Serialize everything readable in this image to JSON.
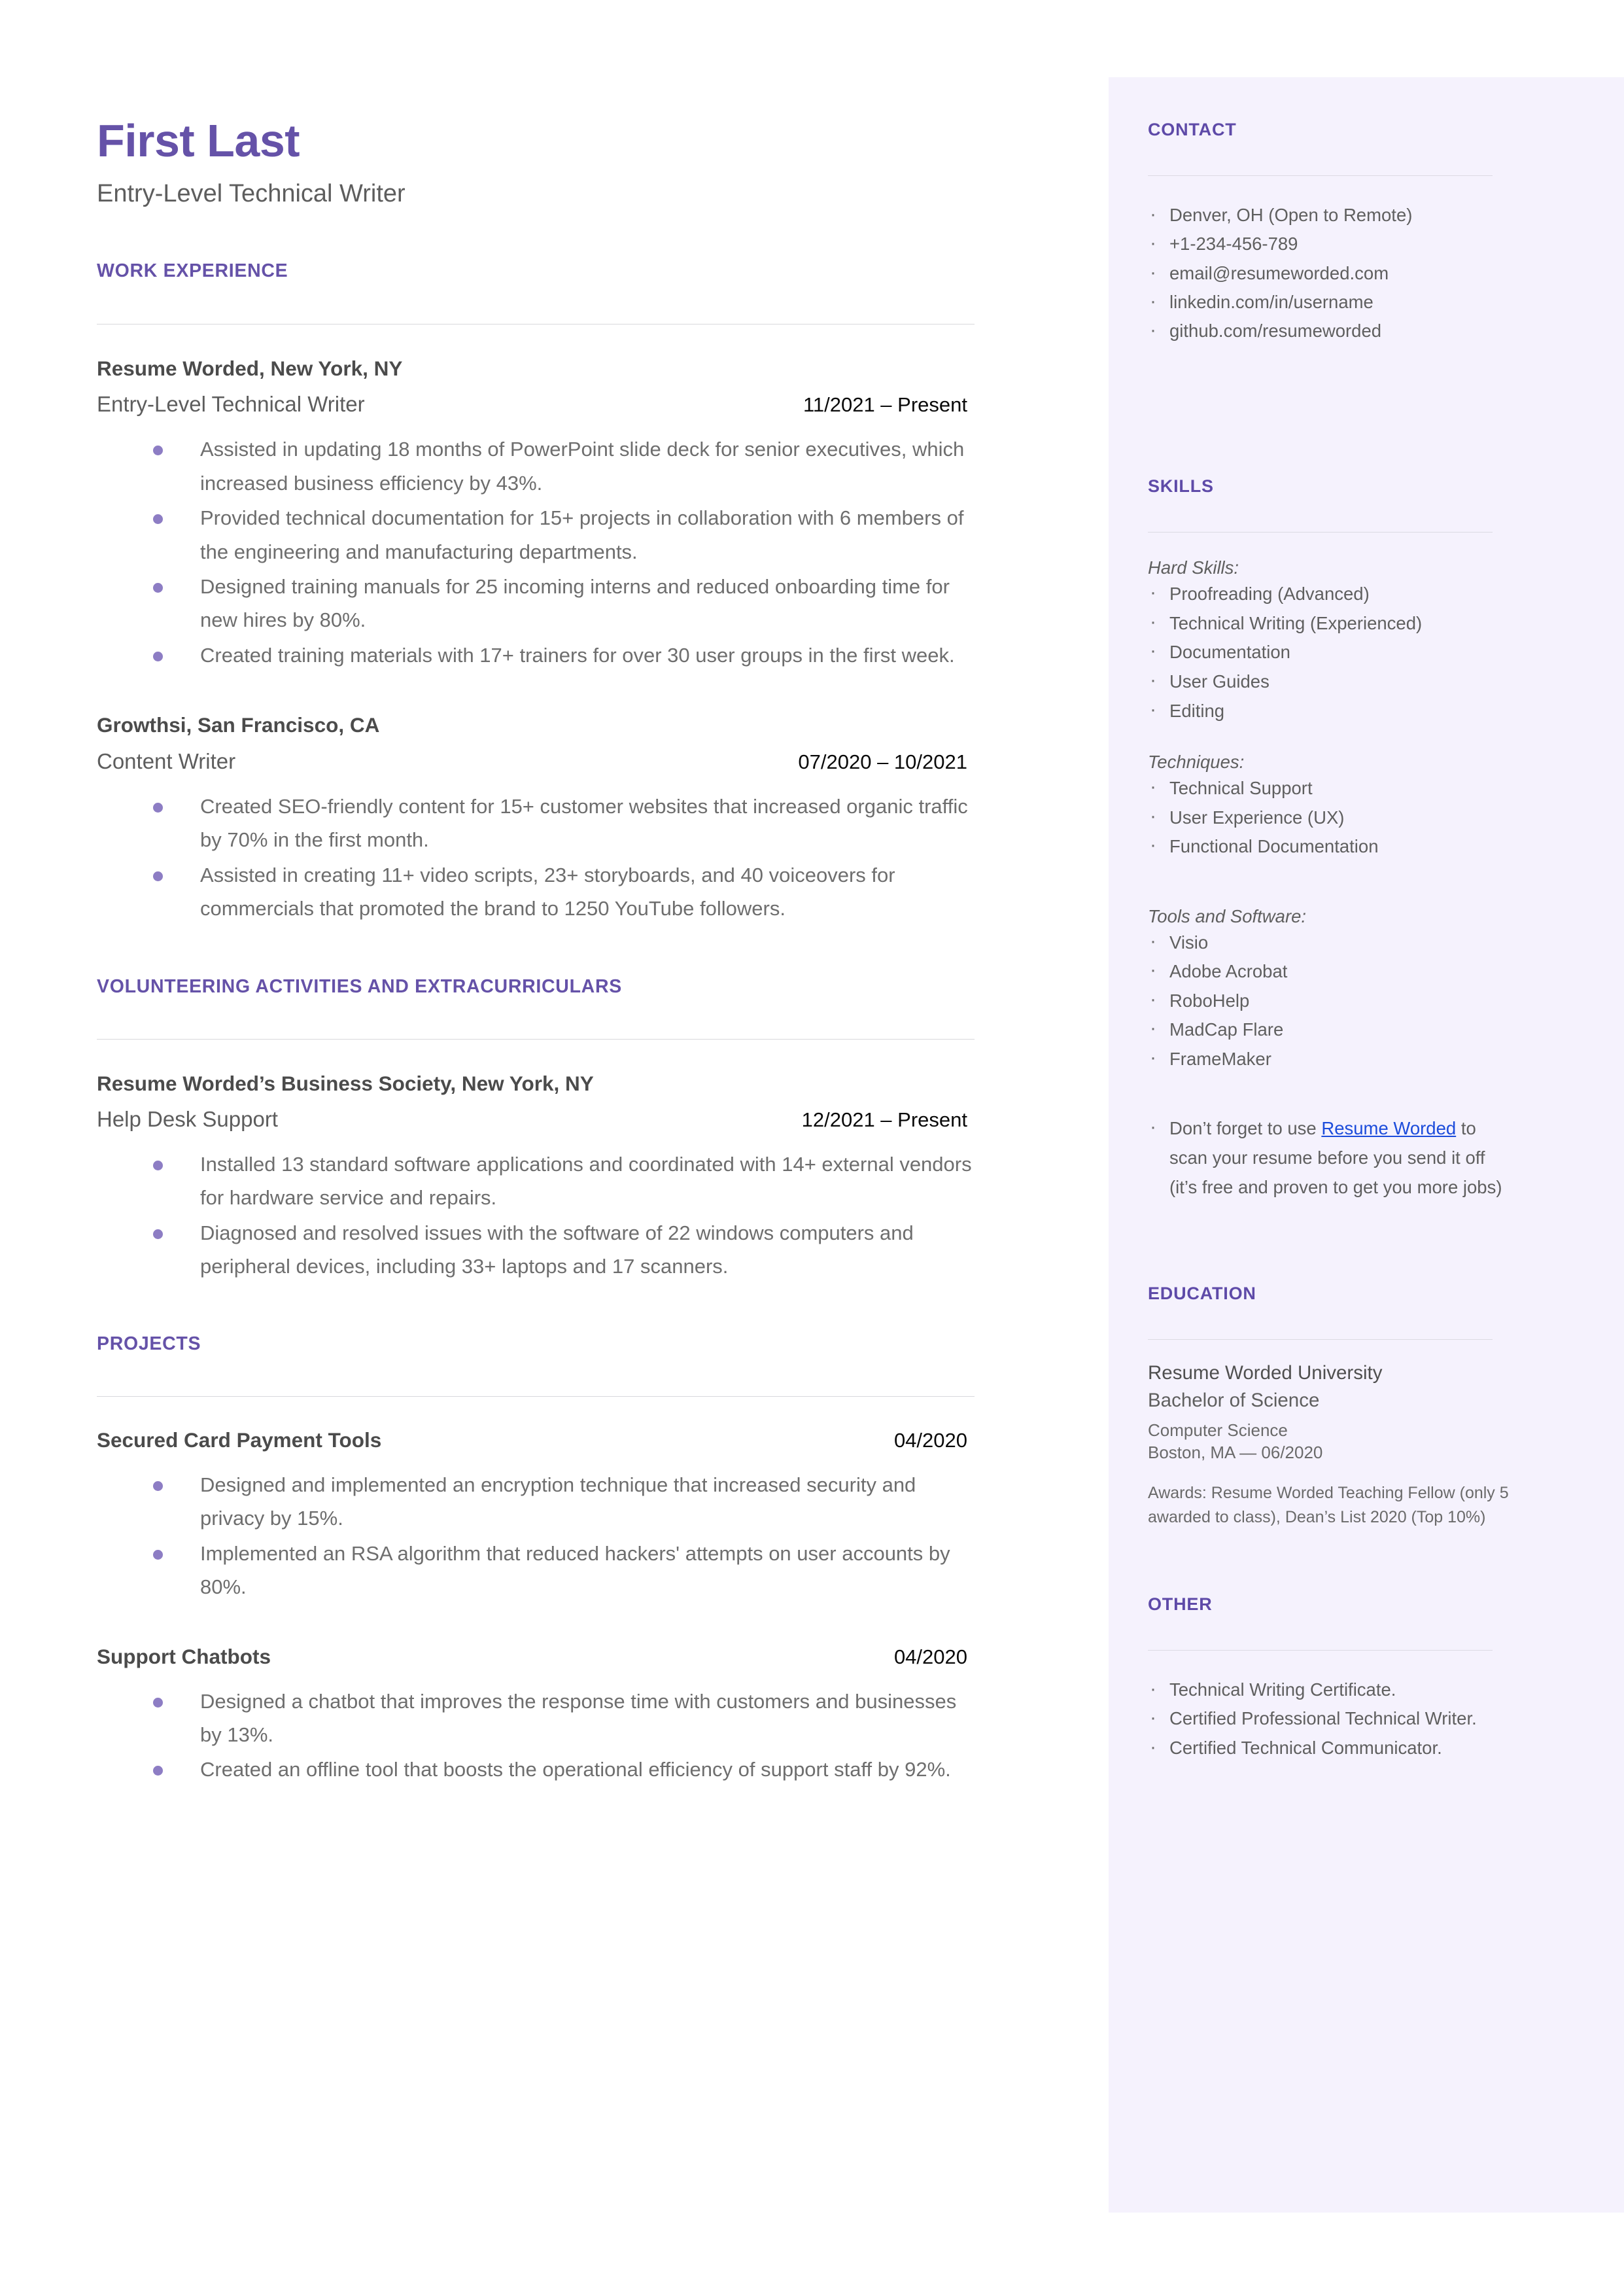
{
  "theme": {
    "accent_purple": "#6552a8",
    "sidebar_purple": "#5e4aa8",
    "sidebar_bg": "#f5f2fd",
    "bullet_purple": "#8d7dc4",
    "link_blue": "#1c4cdb",
    "body_gray": "#6e6e6e"
  },
  "header": {
    "name": "First Last",
    "headline": "Entry-Level Technical Writer"
  },
  "main": {
    "sections": [
      {
        "title": "WORK EXPERIENCE",
        "entries": [
          {
            "org": "Resume Worded, New York, NY",
            "role": "Entry-Level Technical Writer",
            "dates": "11/2021 – Present",
            "bullets": [
              "Assisted in updating 18 months of PowerPoint slide deck for senior executives, which increased business efficiency by 43%.",
              "Provided technical documentation for 15+ projects in collaboration with 6 members of the engineering and manufacturing departments.",
              "Designed training manuals for 25 incoming interns and reduced onboarding time for new hires by 80%.",
              "Created training materials with 17+ trainers for over 30 user groups in the first week."
            ]
          },
          {
            "org": "Growthsi, San Francisco, CA",
            "role": "Content Writer",
            "dates": "07/2020 – 10/2021",
            "bullets": [
              "Created SEO-friendly content for 15+ customer websites that increased organic traffic by 70% in the first month.",
              "Assisted in creating 11+ video scripts, 23+ storyboards, and 40 voiceovers for commercials that promoted the brand to 1250 YouTube followers."
            ]
          }
        ]
      },
      {
        "title": "VOLUNTEERING ACTIVITIES AND EXTRACURRICULARS",
        "entries": [
          {
            "org": "Resume Worded’s Business Society, New York, NY",
            "role": "Help Desk Support",
            "dates": "12/2021 – Present",
            "bullets": [
              "Installed 13 standard software applications and coordinated with 14+ external vendors for hardware service and repairs.",
              "Diagnosed and resolved issues with the software of 22 windows computers and peripheral devices, including 33+ laptops and 17 scanners."
            ]
          }
        ]
      },
      {
        "title": "PROJECTS",
        "projects": [
          {
            "title": "Secured Card Payment Tools",
            "date": "04/2020",
            "bullets": [
              "Designed and implemented an encryption technique that increased security and privacy by 15%.",
              "Implemented an RSA algorithm that reduced hackers' attempts on user accounts by 80%."
            ]
          },
          {
            "title": "Support Chatbots",
            "date": "04/2020",
            "bullets": [
              "Designed a chatbot that improves the response time with customers and businesses by 13%.",
              "Created an offline tool that boosts the operational efficiency of support staff by 92%."
            ]
          }
        ]
      }
    ]
  },
  "sidebar": {
    "contact": {
      "title": "CONTACT",
      "items": [
        "Denver, OH (Open to Remote)",
        "+1-234-456-789",
        "email@resumeworded.com",
        "linkedin.com/in/username",
        "github.com/resumeworded"
      ]
    },
    "skills": {
      "title": "SKILLS",
      "groups": [
        {
          "label": "Hard Skills:",
          "items": [
            "Proofreading (Advanced)",
            "Technical Writing (Experienced)",
            "Documentation",
            "User Guides",
            "Editing"
          ]
        },
        {
          "label": "Techniques:",
          "items": [
            "Technical Support",
            "User Experience (UX)",
            "Functional Documentation"
          ]
        },
        {
          "label": "Tools and Software:",
          "items": [
            "Visio",
            "Adobe Acrobat",
            "RoboHelp",
            "MadCap Flare",
            "FrameMaker"
          ]
        }
      ],
      "promo": {
        "before": "Don’t forget to use ",
        "link": "Resume Worded",
        "after": " to scan your resume before you send it off (it’s free and proven to get you more jobs)"
      }
    },
    "education": {
      "title": "EDUCATION",
      "school": "Resume Worded University",
      "degree": "Bachelor of Science",
      "major": "Computer Science",
      "location_date": "Boston, MA — 06/2020",
      "awards": "Awards: Resume Worded Teaching Fellow (only 5 awarded to class), Dean’s List 2020 (Top 10%)"
    },
    "other": {
      "title": "OTHER",
      "items": [
        "Technical Writing Certificate.",
        "Certified Professional Technical Writer.",
        "Certified Technical Communicator."
      ]
    }
  }
}
